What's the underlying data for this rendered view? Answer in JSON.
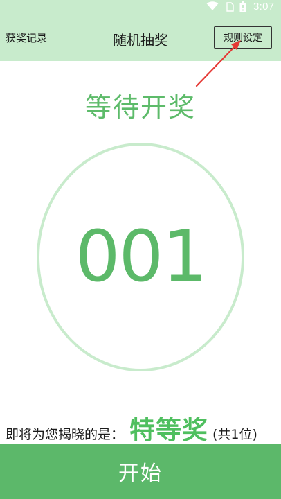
{
  "status_bar": {
    "time": "3:07",
    "icons": [
      "wifi-icon",
      "sim-card-icon",
      "battery-icon"
    ]
  },
  "header": {
    "left_link": "获奖记录",
    "title": "随机抽奖",
    "right_button": "规则设定"
  },
  "main": {
    "status_text": "等待开奖",
    "number": "001",
    "prize_prefix": "即将为您揭晓的是：",
    "prize_name": "特等奖",
    "prize_count": "(共1位)"
  },
  "footer": {
    "start_label": "开始"
  },
  "colors": {
    "accent": "#5cb86a",
    "header_bg": "#c8ebcc",
    "ring": "#c8ebcc",
    "annotation_arrow": "#e53935"
  }
}
